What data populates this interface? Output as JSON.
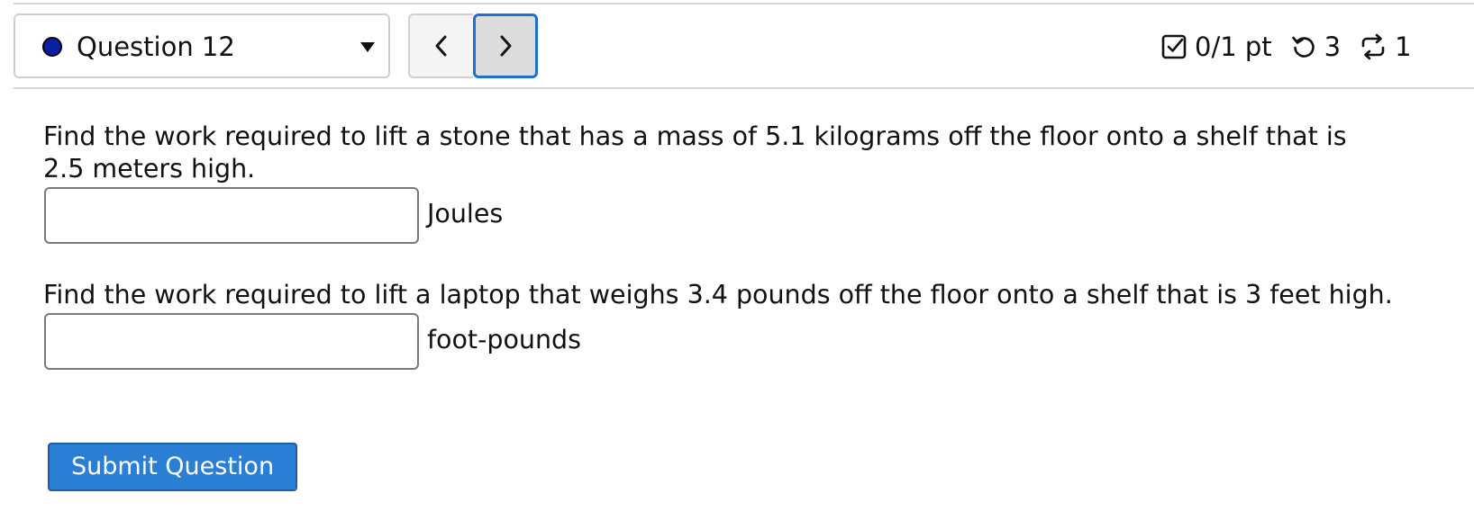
{
  "header": {
    "question_label": "Question 12",
    "status_color": "#0a1fa8",
    "selector_icon": "caret-down-icon",
    "prev_icon": "chevron-left-icon",
    "next_icon": "chevron-right-icon",
    "score_icon": "checkbox-icon",
    "score_text": "0/1 pt",
    "retry_icon": "retry-icon",
    "retries": "3",
    "submissions_icon": "submissions-icon",
    "submissions": "1"
  },
  "questions": [
    {
      "text": "Find the work required to lift a stone that has a mass of 5.1 kilograms off the floor onto a shelf that is 2.5 meters high.",
      "input_value": "",
      "unit": "Joules"
    },
    {
      "text": "Find the work required to lift a laptop that weighs 3.4 pounds off the floor onto a shelf that is 3 feet high.",
      "input_value": "",
      "unit": "foot-pounds"
    }
  ],
  "submit_label": "Submit Question",
  "colors": {
    "accent": "#2a7fd4",
    "focus_border": "#1f6fd1",
    "status_dot": "#0a1fa8"
  }
}
